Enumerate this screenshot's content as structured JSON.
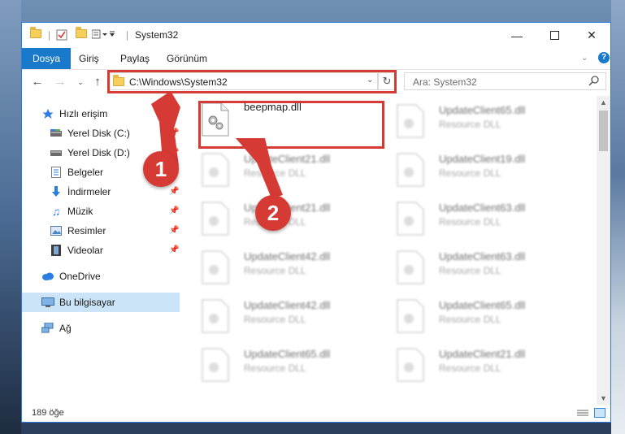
{
  "window": {
    "title": "System32"
  },
  "ribbon": {
    "tabs": [
      "Dosya",
      "Giriş",
      "Paylaş",
      "Görünüm"
    ]
  },
  "address": {
    "path": "C:\\Windows\\System32"
  },
  "search": {
    "placeholder": "Ara: System32"
  },
  "sidebar": {
    "quick_access": "Hızlı erişim",
    "items": [
      "Yerel Disk (C:)",
      "Yerel Disk (D:)",
      "Belgeler",
      "İndirmeler",
      "Müzik",
      "Resimler",
      "Videolar"
    ],
    "onedrive": "OneDrive",
    "this_pc": "Bu bilgisayar",
    "network": "Ağ"
  },
  "files": {
    "highlighted": {
      "name": "beepmap.dll"
    },
    "type": "Resource DLL",
    "left_col": [
      "UpdateClient21.dll",
      "UpdateClient21.dll",
      "UpdateClient42.dll",
      "UpdateClient42.dll",
      "UpdateClient65.dll"
    ],
    "right_col": [
      "UpdateClient65.dll",
      "UpdateClient19.dll",
      "UpdateClient63.dll",
      "UpdateClient63.dll",
      "UpdateClient65.dll",
      "UpdateClient21.dll"
    ]
  },
  "status": {
    "count": "189 öğe"
  },
  "annotations": {
    "step1": "1",
    "step2": "2"
  },
  "colors": {
    "accent": "#1979ca",
    "annotation": "#d63a35"
  }
}
